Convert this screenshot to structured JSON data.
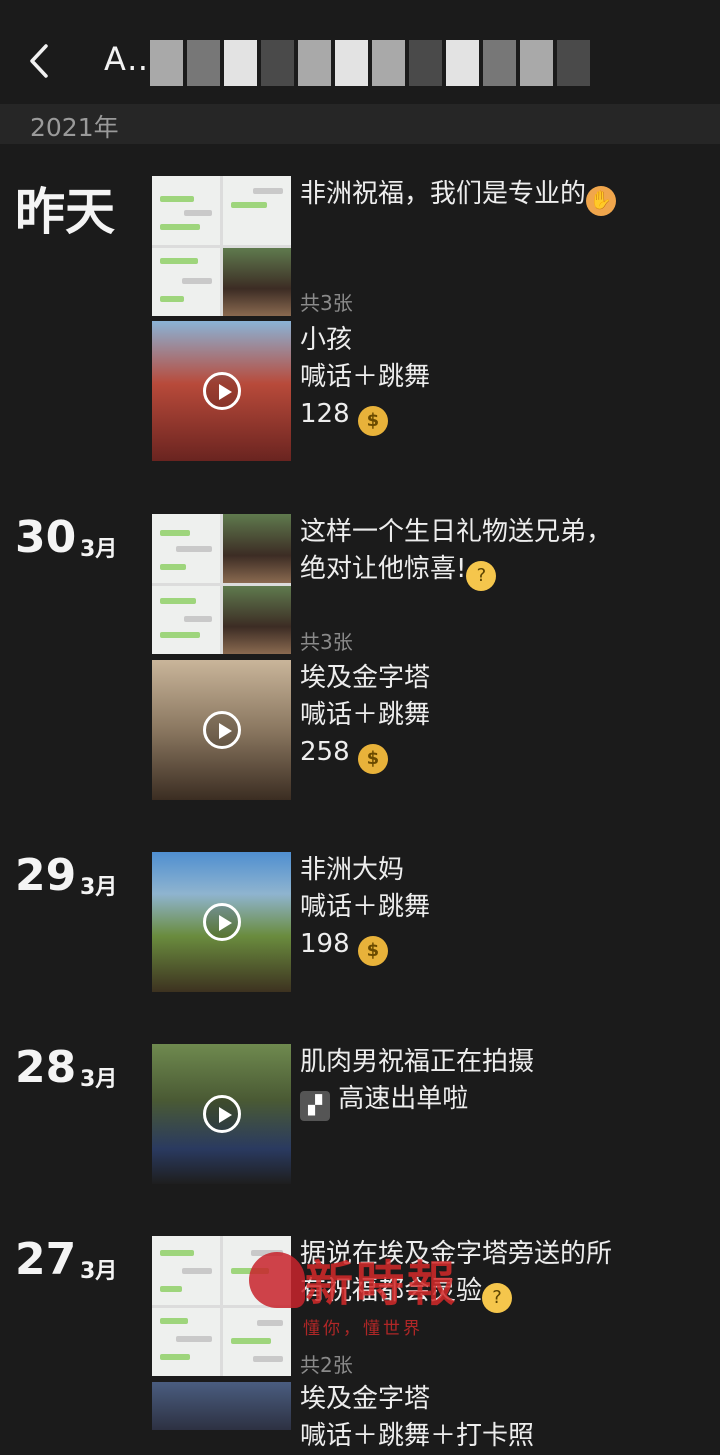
{
  "header": {
    "title": "A…"
  },
  "year_label": "2021年",
  "entries": [
    {
      "date": "昨天",
      "items": [
        {
          "kind": "images",
          "caption": "非洲祝福，我们是专业的",
          "emoji": "handshake",
          "count": "共3张"
        },
        {
          "kind": "video",
          "caption1": "小孩",
          "caption2": "喊话＋跳舞",
          "price": "128",
          "emoji": "money-bag"
        }
      ]
    },
    {
      "day": "30",
      "month": "3月",
      "items": [
        {
          "kind": "images",
          "caption1": "这样一个生日礼物送兄弟，",
          "caption2": "绝对让他惊喜!",
          "emoji": "thinking-face",
          "count": "共3张"
        },
        {
          "kind": "video",
          "caption1": "埃及金字塔",
          "caption2": "喊话＋跳舞",
          "price": "258",
          "emoji": "money-bag"
        }
      ]
    },
    {
      "day": "29",
      "month": "3月",
      "items": [
        {
          "kind": "video",
          "caption1": "非洲大妈",
          "caption2": "喊话＋跳舞",
          "price": "198",
          "emoji": "money-bag"
        }
      ]
    },
    {
      "day": "28",
      "month": "3月",
      "items": [
        {
          "kind": "video",
          "caption1": "肌肉男祝福正在拍摄",
          "caption2": "高速出单啦",
          "emoji": "clapper-board"
        }
      ]
    },
    {
      "day": "27",
      "month": "3月",
      "items": [
        {
          "kind": "images",
          "caption1": "据说在埃及金字塔旁送的所",
          "caption2": "有祝福都会灵验",
          "emoji": "thinking-face",
          "count": "共2张"
        },
        {
          "kind": "video",
          "caption1": "埃及金字塔",
          "caption2": "喊话＋跳舞＋打卡照"
        }
      ]
    }
  ],
  "watermark": {
    "name": "新時報",
    "slogan": "懂你，懂世界"
  }
}
